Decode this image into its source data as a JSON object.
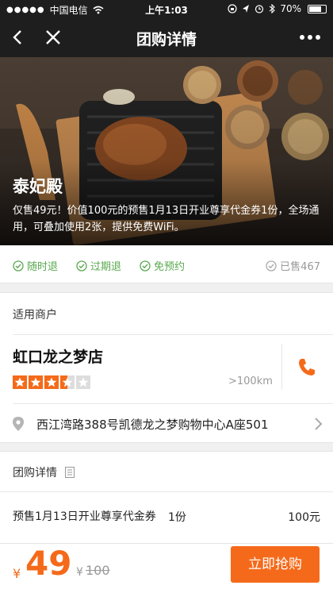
{
  "status_bar": {
    "carrier": "中国电信",
    "time": "上午1:03",
    "battery": "70%"
  },
  "nav": {
    "title": "团购详情",
    "icons": [
      "back-icon",
      "close-icon",
      "more-icon"
    ]
  },
  "hero": {
    "shop_name": "泰妃殿",
    "description": "仅售49元！价值100元的预售1月13日开业尊享代金券1份，全场通用，可叠加使用2张，提供免费WiFi。"
  },
  "features": {
    "items": [
      "随时退",
      "过期退",
      "免预约"
    ],
    "sold": "已售467"
  },
  "merchant": {
    "section_label": "适用商户",
    "name": "虹口龙之梦店",
    "rating": 3.5,
    "rating_max": 5,
    "distance": ">100km",
    "address": "西江湾路388号凯德龙之梦购物中心A座501"
  },
  "deal_detail": {
    "section_label": "团购详情",
    "rows": [
      {
        "name": "预售1月13日开业尊享代金券",
        "qty": "1份",
        "price": "100元"
      }
    ]
  },
  "bottom": {
    "currency": "¥",
    "price": "49",
    "orig_currency": "¥",
    "orig_price": "100",
    "buy_label": "立即抢购"
  },
  "colors": {
    "accent": "#f56a1a",
    "green": "#5aa84f",
    "dark_bar": "#1e1e1e"
  }
}
